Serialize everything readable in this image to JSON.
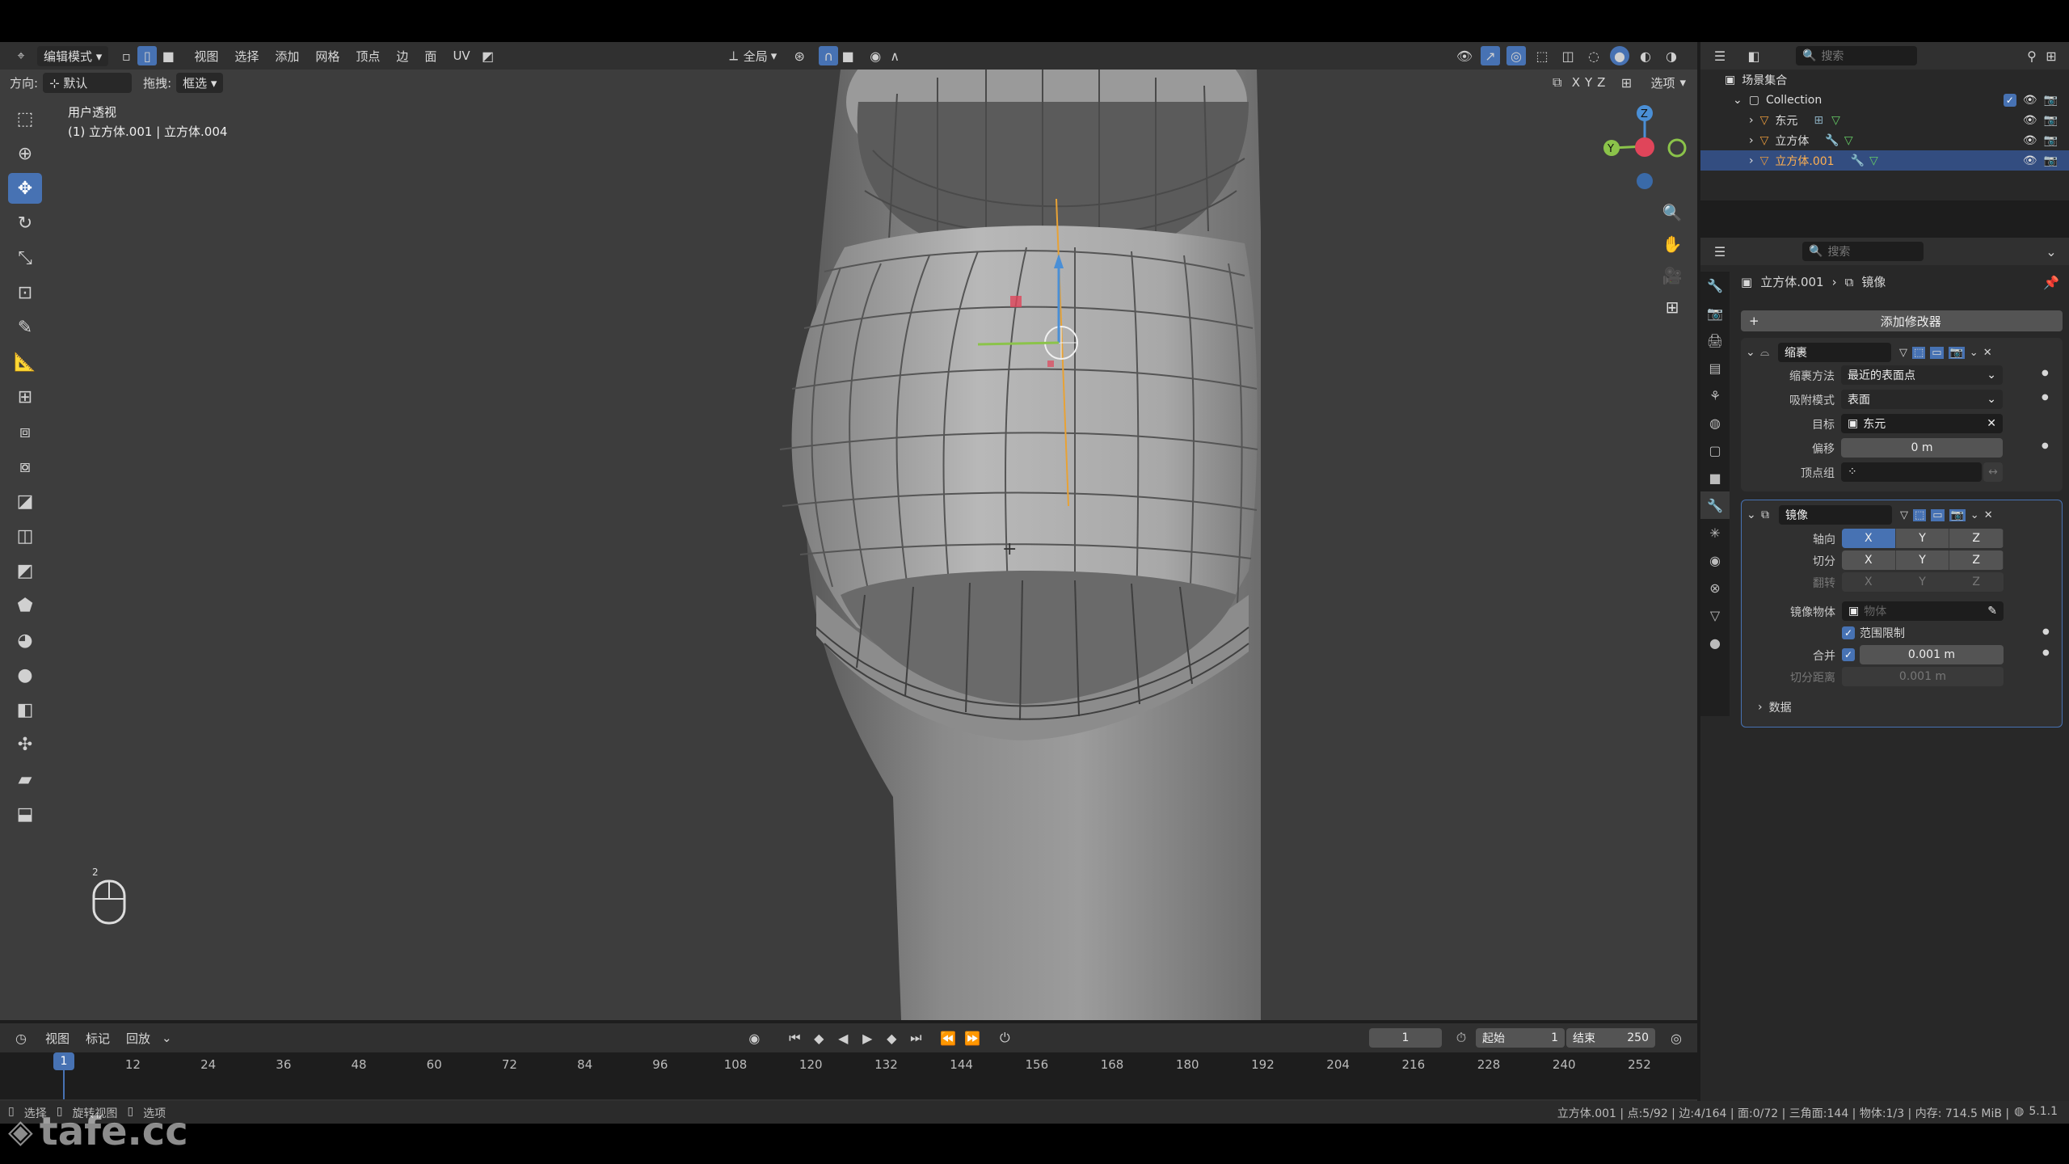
{
  "header": {
    "mode": "编辑模式",
    "menus": [
      "视图",
      "选择",
      "添加",
      "网格",
      "顶点",
      "边",
      "面",
      "UV"
    ],
    "orientation_label": "方向:",
    "orientation_value": "默认",
    "drag_label": "拖拽:",
    "drag_value": "框选",
    "pivot_value": "全局",
    "axes": [
      "X",
      "Y",
      "Z"
    ],
    "options_label": "选项"
  },
  "viewport": {
    "view_name": "用户透视",
    "object_info": "(1) 立方体.001 | 立方体.004",
    "mouse_hint": "2"
  },
  "outliner": {
    "search_placeholder": "搜索",
    "scene_collection": "场景集合",
    "collection": "Collection",
    "items": [
      {
        "label": "东元"
      },
      {
        "label": "立方体"
      },
      {
        "label": "立方体.001"
      }
    ]
  },
  "properties": {
    "search_placeholder": "搜索",
    "breadcrumb_object": "立方体.001",
    "breadcrumb_modifier": "镜像",
    "add_modifier": "添加修改器",
    "shrinkwrap": {
      "name": "缩裹",
      "method_label": "缩裹方法",
      "method_value": "最近的表面点",
      "snap_label": "吸附模式",
      "snap_value": "表面",
      "target_label": "目标",
      "target_value": "东元",
      "offset_label": "偏移",
      "offset_value": "0 m",
      "vgroup_label": "顶点组"
    },
    "mirror": {
      "name": "镜像",
      "axis_label": "轴向",
      "bisect_label": "切分",
      "flip_label": "翻转",
      "xyz": [
        "X",
        "Y",
        "Z"
      ],
      "mirror_obj_label": "镜像物体",
      "mirror_obj_placeholder": "物体",
      "clipping_label": "范围限制",
      "merge_label": "合并",
      "merge_value": "0.001 m",
      "bisect_dist_label": "切分距离",
      "bisect_dist_value": "0.001 m",
      "data_label": "数据"
    }
  },
  "timeline": {
    "menus": [
      "视图",
      "标记",
      "回放"
    ],
    "current_frame": "1",
    "start_label": "起始",
    "start_value": "1",
    "end_label": "结束",
    "end_value": "250",
    "ticks": [
      "1",
      "12",
      "24",
      "36",
      "48",
      "60",
      "72",
      "84",
      "96",
      "108",
      "120",
      "132",
      "144",
      "156",
      "168",
      "180",
      "192",
      "204",
      "216",
      "228",
      "240",
      "252"
    ]
  },
  "status": {
    "select": "选择",
    "rotate": "旋转视图",
    "options": "选项",
    "stats": "立方体.001 | 点:5/92 | 边:4/164 | 面:0/72 | 三角面:144 | 物体:1/3 | 内存: 714.5 MiB | ",
    "version": "5.1.1"
  },
  "watermark": "tafe.cc",
  "colors": {
    "accent": "#4772b3",
    "panel": "#303030",
    "viewport": "#3d3d3d",
    "axis_x": "#e0455a",
    "axis_y": "#8bc34a",
    "axis_z": "#4a8fd6"
  }
}
